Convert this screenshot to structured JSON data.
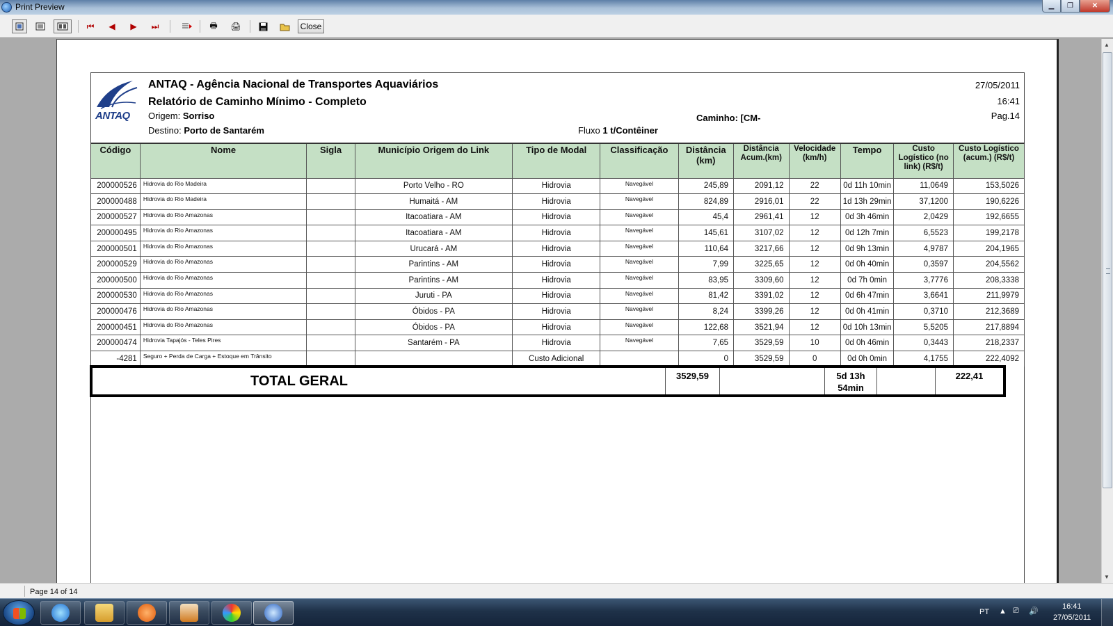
{
  "window": {
    "title": "Print Preview",
    "close_label": "Close"
  },
  "toolbar": {
    "icons": [
      "one-page-icon",
      "two-page-icon",
      "multi-page-icon",
      "first-page-icon",
      "prev-page-icon",
      "next-page-icon",
      "last-page-icon",
      "goto-page-icon",
      "print-setup-icon",
      "print-icon",
      "save-icon",
      "open-icon"
    ]
  },
  "report": {
    "org_title": "ANTAQ - Agência Nacional de Transportes Aquaviários",
    "report_title": "Relatório de Caminho Mínimo - Completo",
    "logo_text": "ANTAQ",
    "origin_label": "Origem:",
    "origin_value": "Sorriso",
    "dest_label": "Destino:",
    "dest_value": "Porto de Santarém",
    "path_label": "Caminho: [CM-",
    "flow_label": "Fluxo",
    "flow_value": "1 t/Contêiner",
    "date": "27/05/2011",
    "time": "16:41",
    "page": "Pag.14",
    "columns": [
      "Código",
      "Nome",
      "Sigla",
      "Município Origem do Link",
      "Tipo de Modal",
      "Classificação",
      "Distância (km)",
      "Distância Acum.(km)",
      "Velocidade (km/h)",
      "Tempo",
      "Custo Logístico (no link) (R$/t)",
      "Custo Logístico (acum.) (R$/t)"
    ],
    "rows": [
      {
        "code": "200000526",
        "name": "Hidrovia do Rio Madeira",
        "sigla": "",
        "mun": "Porto Velho - RO",
        "modal": "Hidrovia",
        "cls": "Navegável",
        "dist": "245,89",
        "acum": "2091,12",
        "vel": "22",
        "tempo": "0d 11h 10min",
        "custo": "11,0649",
        "custo_acum": "153,5026"
      },
      {
        "code": "200000488",
        "name": "Hidrovia do Rio Madeira",
        "sigla": "",
        "mun": "Humaitá - AM",
        "modal": "Hidrovia",
        "cls": "Navegável",
        "dist": "824,89",
        "acum": "2916,01",
        "vel": "22",
        "tempo": "1d 13h 29min",
        "custo": "37,1200",
        "custo_acum": "190,6226"
      },
      {
        "code": "200000527",
        "name": "Hidrovia do Rio Amazonas",
        "sigla": "",
        "mun": "Itacoatiara - AM",
        "modal": "Hidrovia",
        "cls": "Navegável",
        "dist": "45,4",
        "acum": "2961,41",
        "vel": "12",
        "tempo": "0d 3h 46min",
        "custo": "2,0429",
        "custo_acum": "192,6655"
      },
      {
        "code": "200000495",
        "name": "Hidrovia do Rio Amazonas",
        "sigla": "",
        "mun": "Itacoatiara - AM",
        "modal": "Hidrovia",
        "cls": "Navegável",
        "dist": "145,61",
        "acum": "3107,02",
        "vel": "12",
        "tempo": "0d 12h 7min",
        "custo": "6,5523",
        "custo_acum": "199,2178"
      },
      {
        "code": "200000501",
        "name": "Hidrovia do Rio Amazonas",
        "sigla": "",
        "mun": "Urucará - AM",
        "modal": "Hidrovia",
        "cls": "Navegável",
        "dist": "110,64",
        "acum": "3217,66",
        "vel": "12",
        "tempo": "0d 9h 13min",
        "custo": "4,9787",
        "custo_acum": "204,1965"
      },
      {
        "code": "200000529",
        "name": "Hidrovia do Rio Amazonas",
        "sigla": "",
        "mun": "Parintins - AM",
        "modal": "Hidrovia",
        "cls": "Navegável",
        "dist": "7,99",
        "acum": "3225,65",
        "vel": "12",
        "tempo": "0d 0h 40min",
        "custo": "0,3597",
        "custo_acum": "204,5562"
      },
      {
        "code": "200000500",
        "name": "Hidrovia do Rio Amazonas",
        "sigla": "",
        "mun": "Parintins - AM",
        "modal": "Hidrovia",
        "cls": "Navegável",
        "dist": "83,95",
        "acum": "3309,60",
        "vel": "12",
        "tempo": "0d 7h 0min",
        "custo": "3,7776",
        "custo_acum": "208,3338"
      },
      {
        "code": "200000530",
        "name": "Hidrovia do Rio Amazonas",
        "sigla": "",
        "mun": "Juruti - PA",
        "modal": "Hidrovia",
        "cls": "Navegável",
        "dist": "81,42",
        "acum": "3391,02",
        "vel": "12",
        "tempo": "0d 6h 47min",
        "custo": "3,6641",
        "custo_acum": "211,9979"
      },
      {
        "code": "200000476",
        "name": "Hidrovia do Rio Amazonas",
        "sigla": "",
        "mun": "Óbidos - PA",
        "modal": "Hidrovia",
        "cls": "Navegável",
        "dist": "8,24",
        "acum": "3399,26",
        "vel": "12",
        "tempo": "0d 0h 41min",
        "custo": "0,3710",
        "custo_acum": "212,3689"
      },
      {
        "code": "200000451",
        "name": "Hidrovia do Rio Amazonas",
        "sigla": "",
        "mun": "Óbidos - PA",
        "modal": "Hidrovia",
        "cls": "Navegável",
        "dist": "122,68",
        "acum": "3521,94",
        "vel": "12",
        "tempo": "0d 10h 13min",
        "custo": "5,5205",
        "custo_acum": "217,8894"
      },
      {
        "code": "200000474",
        "name": "Hidrovia Tapajós - Teles Pires",
        "sigla": "",
        "mun": "Santarém - PA",
        "modal": "Hidrovia",
        "cls": "Navegável",
        "dist": "7,65",
        "acum": "3529,59",
        "vel": "10",
        "tempo": "0d 0h 46min",
        "custo": "0,3443",
        "custo_acum": "218,2337"
      },
      {
        "code": "-4281",
        "name": "Seguro + Perda de Carga + Estoque em Trânsito",
        "sigla": "",
        "mun": "",
        "modal": "Custo Adicional",
        "cls": "",
        "dist": "0",
        "acum": "3529,59",
        "vel": "0",
        "tempo": "0d 0h 0min",
        "custo": "4,1755",
        "custo_acum": "222,4092"
      }
    ],
    "total_label": "TOTAL GERAL",
    "total_dist": "3529,59",
    "total_tempo": "5d 13h 54min",
    "total_custo": "222,41"
  },
  "status": {
    "page_indicator": "Page 14 of 14"
  },
  "taskbar": {
    "apps": [
      "internet-explorer-icon",
      "file-explorer-icon",
      "media-player-icon",
      "office-icon",
      "paint-icon",
      "compass-app-icon"
    ],
    "language": "PT",
    "clock_time": "16:41",
    "clock_date": "27/05/2011"
  }
}
